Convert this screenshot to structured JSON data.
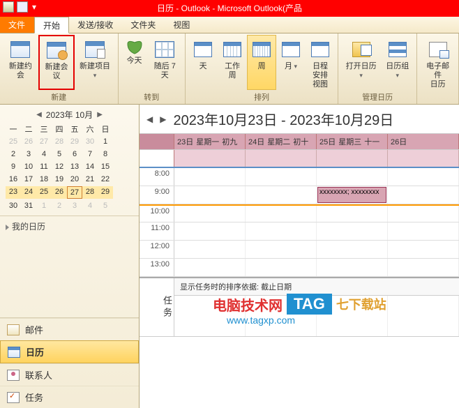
{
  "title": "日历 - Outlook - Microsoft Outlook(产品",
  "tabs": {
    "file": "文件",
    "home": "开始",
    "sendrecv": "发送/接收",
    "folder": "文件夹",
    "view": "视图"
  },
  "ribbon": {
    "new": {
      "appt": "新建约会",
      "meeting": "新建会议",
      "item": "新建项目",
      "label": "新建"
    },
    "goto": {
      "today": "今天",
      "next7": "随后 7 天",
      "label": "转到"
    },
    "arrange": {
      "day": "天",
      "workweek": "工作周",
      "week": "周",
      "month": "月",
      "schedule": "日程安排\n视图",
      "label": "排列"
    },
    "manage": {
      "open": "打开日历",
      "groups": "日历组",
      "label": "管理日历"
    },
    "share": {
      "email": "电子邮件\n日历"
    }
  },
  "datepicker": {
    "month": "2023年 10月",
    "dow": [
      "一",
      "二",
      "三",
      "四",
      "五",
      "六",
      "日"
    ],
    "cells": [
      {
        "d": "25",
        "o": true
      },
      {
        "d": "26",
        "o": true
      },
      {
        "d": "27",
        "o": true
      },
      {
        "d": "28",
        "o": true
      },
      {
        "d": "29",
        "o": true
      },
      {
        "d": "30",
        "o": true
      },
      {
        "d": "1"
      },
      {
        "d": "2"
      },
      {
        "d": "3"
      },
      {
        "d": "4"
      },
      {
        "d": "5"
      },
      {
        "d": "6"
      },
      {
        "d": "7"
      },
      {
        "d": "8"
      },
      {
        "d": "9"
      },
      {
        "d": "10"
      },
      {
        "d": "11"
      },
      {
        "d": "12"
      },
      {
        "d": "13"
      },
      {
        "d": "14"
      },
      {
        "d": "15"
      },
      {
        "d": "16"
      },
      {
        "d": "17"
      },
      {
        "d": "18"
      },
      {
        "d": "19"
      },
      {
        "d": "20"
      },
      {
        "d": "21"
      },
      {
        "d": "22"
      },
      {
        "d": "23",
        "s": true
      },
      {
        "d": "24",
        "s": true
      },
      {
        "d": "25",
        "s": true
      },
      {
        "d": "26",
        "s": true
      },
      {
        "d": "27",
        "s": true,
        "t": true
      },
      {
        "d": "28",
        "s": true
      },
      {
        "d": "29",
        "s": true
      },
      {
        "d": "30"
      },
      {
        "d": "31"
      },
      {
        "d": "1",
        "o": true
      },
      {
        "d": "2",
        "o": true
      },
      {
        "d": "3",
        "o": true
      },
      {
        "d": "4",
        "o": true
      },
      {
        "d": "5",
        "o": true
      }
    ]
  },
  "mycal": "我的日历",
  "nav": {
    "mail": "邮件",
    "calendar": "日历",
    "contacts": "联系人",
    "tasks": "任务"
  },
  "calview": {
    "title": "2023年10月23日 - 2023年10月29日",
    "days": [
      {
        "d": "23日",
        "w": "星期一",
        "l": "初九"
      },
      {
        "d": "24日",
        "w": "星期二",
        "l": "初十"
      },
      {
        "d": "25日",
        "w": "星期三",
        "l": "十一"
      },
      {
        "d": "26日",
        "w": "",
        "l": ""
      }
    ],
    "hours": [
      "8:00",
      "9:00",
      "10:00",
      "11:00",
      "12:00",
      "13:00"
    ],
    "event": "xxxxxxxx; xxxxxxxx"
  },
  "tasks": {
    "vlabel": "任务",
    "sort": "显示任务时的排序依据: 截止日期"
  },
  "watermark": {
    "text": "电脑技术网",
    "tag": "TAG",
    "site": "七下载站",
    "url": "www.tagxp.com"
  }
}
